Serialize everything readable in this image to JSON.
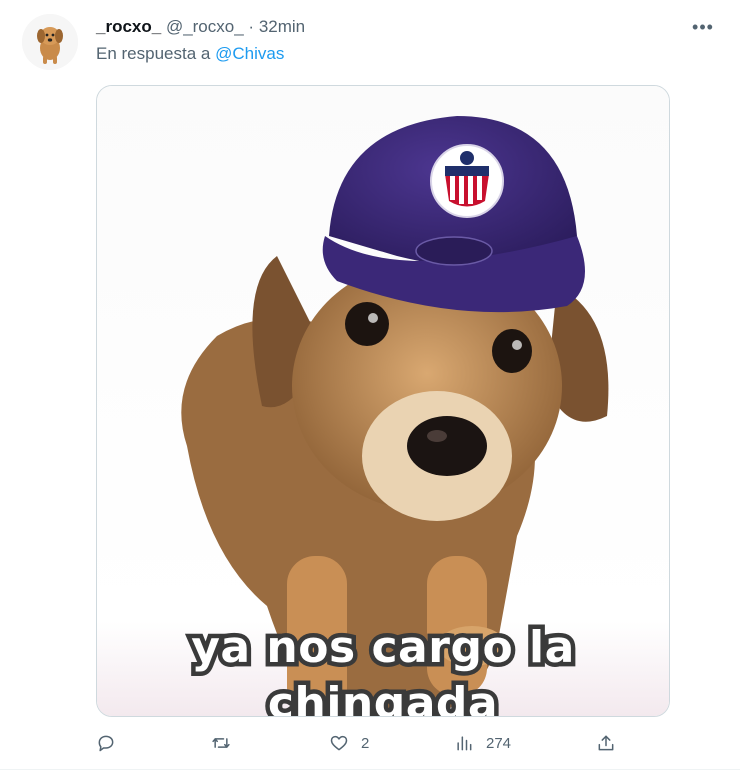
{
  "tweet": {
    "display_name": "_rocxo_",
    "handle": "@_rocxo_",
    "separator": "·",
    "time": "32min",
    "reply_prefix": "En respuesta a",
    "reply_to": "@Chivas",
    "more_icon": "ellipsis-icon",
    "avatar_icon": "dog-avatar",
    "media": {
      "caption_line1": "ya nos cargo la",
      "caption_line2": "chingada",
      "cap_color": "#3e2a7a"
    },
    "actions": {
      "reply": {
        "icon": "reply-icon",
        "count": ""
      },
      "retweet": {
        "icon": "retweet-icon",
        "count": ""
      },
      "like": {
        "icon": "heart-icon",
        "count": "2"
      },
      "views": {
        "icon": "views-icon",
        "count": "274"
      },
      "share": {
        "icon": "share-icon",
        "count": ""
      }
    }
  }
}
